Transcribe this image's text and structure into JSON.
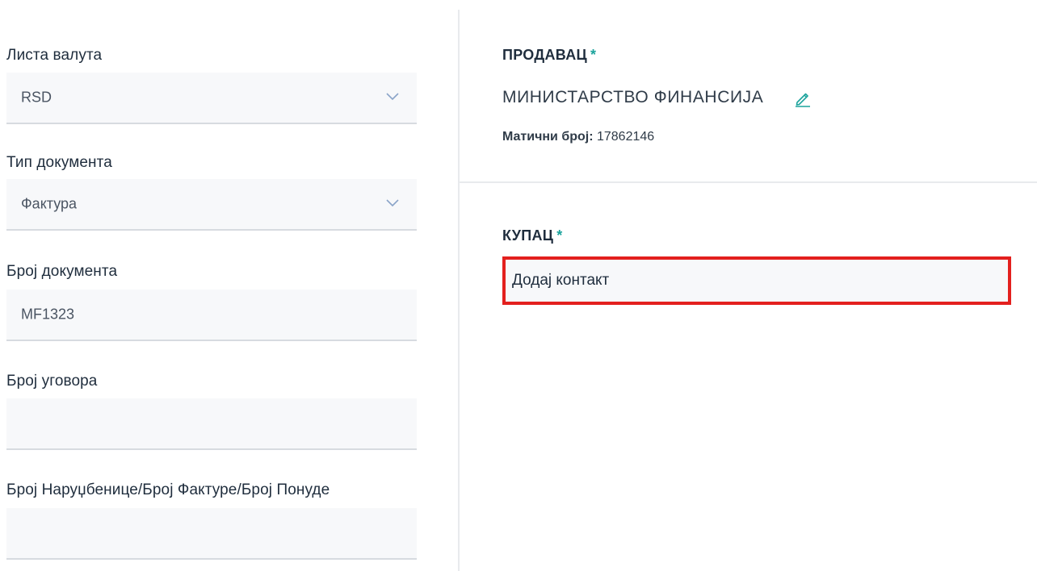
{
  "form": {
    "currency": {
      "label": "Листа валута",
      "value": "RSD"
    },
    "doc_type": {
      "label": "Тип документа",
      "value": "Фактура"
    },
    "doc_number": {
      "label": "Број документа",
      "value": "MF1323"
    },
    "contract_number": {
      "label": "Број уговора",
      "value": ""
    },
    "order_number": {
      "label": "Број Наруџбенице/Број Фактуре/Број Понуде",
      "value": ""
    }
  },
  "seller": {
    "title": "ПРОДАВАЦ",
    "required_mark": "*",
    "name": "МИНИСТАРСТВО ФИНАНСИЈА",
    "reg_label": "Матични број:",
    "reg_value": "17862146",
    "edit_icon": "pencil-icon"
  },
  "buyer": {
    "title": "КУПАЦ",
    "required_mark": "*",
    "add_contact_label": "Додај контакт"
  },
  "colors": {
    "accent": "#1ba39c",
    "highlight_border": "#e3201e",
    "field_bg": "#f7f8fa"
  }
}
